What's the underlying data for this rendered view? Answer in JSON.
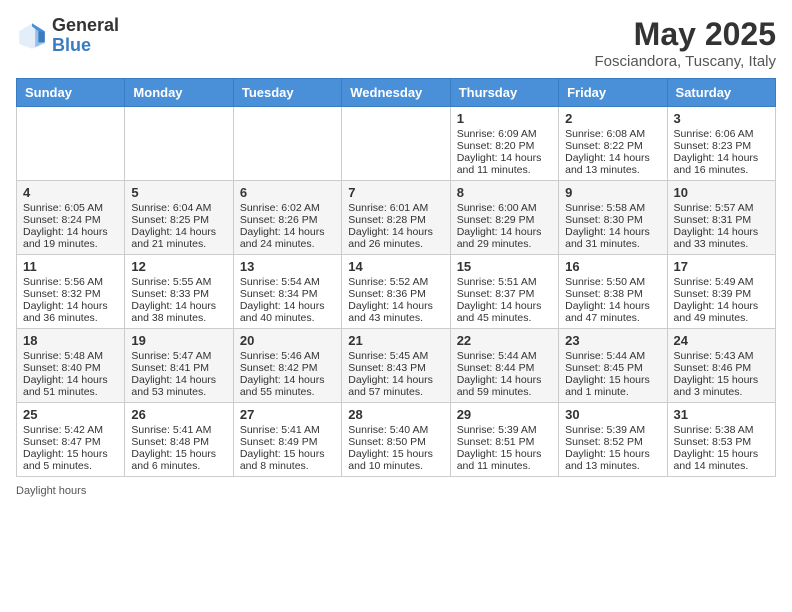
{
  "header": {
    "logo": {
      "general": "General",
      "blue": "Blue"
    },
    "title": "May 2025",
    "subtitle": "Fosciandora, Tuscany, Italy"
  },
  "columns": [
    "Sunday",
    "Monday",
    "Tuesday",
    "Wednesday",
    "Thursday",
    "Friday",
    "Saturday"
  ],
  "weeks": [
    [
      {
        "day": "",
        "content": ""
      },
      {
        "day": "",
        "content": ""
      },
      {
        "day": "",
        "content": ""
      },
      {
        "day": "",
        "content": ""
      },
      {
        "day": "1",
        "content": "Sunrise: 6:09 AM\nSunset: 8:20 PM\nDaylight: 14 hours and 11 minutes."
      },
      {
        "day": "2",
        "content": "Sunrise: 6:08 AM\nSunset: 8:22 PM\nDaylight: 14 hours and 13 minutes."
      },
      {
        "day": "3",
        "content": "Sunrise: 6:06 AM\nSunset: 8:23 PM\nDaylight: 14 hours and 16 minutes."
      }
    ],
    [
      {
        "day": "4",
        "content": "Sunrise: 6:05 AM\nSunset: 8:24 PM\nDaylight: 14 hours and 19 minutes."
      },
      {
        "day": "5",
        "content": "Sunrise: 6:04 AM\nSunset: 8:25 PM\nDaylight: 14 hours and 21 minutes."
      },
      {
        "day": "6",
        "content": "Sunrise: 6:02 AM\nSunset: 8:26 PM\nDaylight: 14 hours and 24 minutes."
      },
      {
        "day": "7",
        "content": "Sunrise: 6:01 AM\nSunset: 8:28 PM\nDaylight: 14 hours and 26 minutes."
      },
      {
        "day": "8",
        "content": "Sunrise: 6:00 AM\nSunset: 8:29 PM\nDaylight: 14 hours and 29 minutes."
      },
      {
        "day": "9",
        "content": "Sunrise: 5:58 AM\nSunset: 8:30 PM\nDaylight: 14 hours and 31 minutes."
      },
      {
        "day": "10",
        "content": "Sunrise: 5:57 AM\nSunset: 8:31 PM\nDaylight: 14 hours and 33 minutes."
      }
    ],
    [
      {
        "day": "11",
        "content": "Sunrise: 5:56 AM\nSunset: 8:32 PM\nDaylight: 14 hours and 36 minutes."
      },
      {
        "day": "12",
        "content": "Sunrise: 5:55 AM\nSunset: 8:33 PM\nDaylight: 14 hours and 38 minutes."
      },
      {
        "day": "13",
        "content": "Sunrise: 5:54 AM\nSunset: 8:34 PM\nDaylight: 14 hours and 40 minutes."
      },
      {
        "day": "14",
        "content": "Sunrise: 5:52 AM\nSunset: 8:36 PM\nDaylight: 14 hours and 43 minutes."
      },
      {
        "day": "15",
        "content": "Sunrise: 5:51 AM\nSunset: 8:37 PM\nDaylight: 14 hours and 45 minutes."
      },
      {
        "day": "16",
        "content": "Sunrise: 5:50 AM\nSunset: 8:38 PM\nDaylight: 14 hours and 47 minutes."
      },
      {
        "day": "17",
        "content": "Sunrise: 5:49 AM\nSunset: 8:39 PM\nDaylight: 14 hours and 49 minutes."
      }
    ],
    [
      {
        "day": "18",
        "content": "Sunrise: 5:48 AM\nSunset: 8:40 PM\nDaylight: 14 hours and 51 minutes."
      },
      {
        "day": "19",
        "content": "Sunrise: 5:47 AM\nSunset: 8:41 PM\nDaylight: 14 hours and 53 minutes."
      },
      {
        "day": "20",
        "content": "Sunrise: 5:46 AM\nSunset: 8:42 PM\nDaylight: 14 hours and 55 minutes."
      },
      {
        "day": "21",
        "content": "Sunrise: 5:45 AM\nSunset: 8:43 PM\nDaylight: 14 hours and 57 minutes."
      },
      {
        "day": "22",
        "content": "Sunrise: 5:44 AM\nSunset: 8:44 PM\nDaylight: 14 hours and 59 minutes."
      },
      {
        "day": "23",
        "content": "Sunrise: 5:44 AM\nSunset: 8:45 PM\nDaylight: 15 hours and 1 minute."
      },
      {
        "day": "24",
        "content": "Sunrise: 5:43 AM\nSunset: 8:46 PM\nDaylight: 15 hours and 3 minutes."
      }
    ],
    [
      {
        "day": "25",
        "content": "Sunrise: 5:42 AM\nSunset: 8:47 PM\nDaylight: 15 hours and 5 minutes."
      },
      {
        "day": "26",
        "content": "Sunrise: 5:41 AM\nSunset: 8:48 PM\nDaylight: 15 hours and 6 minutes."
      },
      {
        "day": "27",
        "content": "Sunrise: 5:41 AM\nSunset: 8:49 PM\nDaylight: 15 hours and 8 minutes."
      },
      {
        "day": "28",
        "content": "Sunrise: 5:40 AM\nSunset: 8:50 PM\nDaylight: 15 hours and 10 minutes."
      },
      {
        "day": "29",
        "content": "Sunrise: 5:39 AM\nSunset: 8:51 PM\nDaylight: 15 hours and 11 minutes."
      },
      {
        "day": "30",
        "content": "Sunrise: 5:39 AM\nSunset: 8:52 PM\nDaylight: 15 hours and 13 minutes."
      },
      {
        "day": "31",
        "content": "Sunrise: 5:38 AM\nSunset: 8:53 PM\nDaylight: 15 hours and 14 minutes."
      }
    ]
  ],
  "footer": "Daylight hours"
}
